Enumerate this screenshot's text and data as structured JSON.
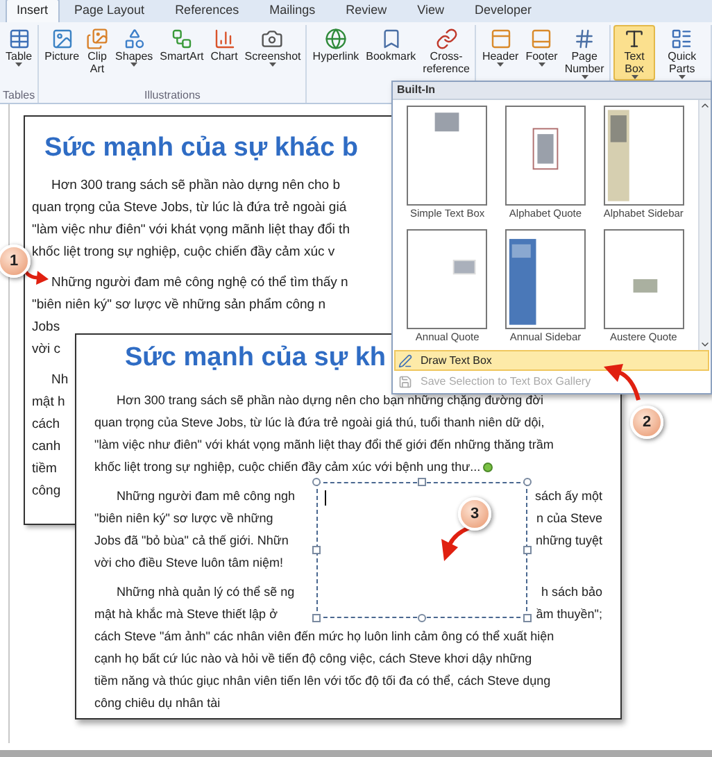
{
  "ribbon": {
    "tabs": [
      {
        "label": "Insert",
        "selected": true
      },
      {
        "label": "Page Layout",
        "selected": false
      },
      {
        "label": "References",
        "selected": false
      },
      {
        "label": "Mailings",
        "selected": false
      },
      {
        "label": "Review",
        "selected": false
      },
      {
        "label": "View",
        "selected": false
      },
      {
        "label": "Developer",
        "selected": false
      }
    ],
    "groups": [
      {
        "label": "Tables",
        "buttons": [
          {
            "label": "Table",
            "kind": "table",
            "dropdown": true,
            "selected": false
          }
        ]
      },
      {
        "label": "Illustrations",
        "buttons": [
          {
            "label": "Picture",
            "kind": "picture",
            "dropdown": false,
            "selected": false
          },
          {
            "label": "Clip Art",
            "kind": "clipart",
            "dropdown": false,
            "selected": false
          },
          {
            "label": "Shapes",
            "kind": "shapes",
            "dropdown": true,
            "selected": false
          },
          {
            "label": "SmartArt",
            "kind": "smartart",
            "dropdown": false,
            "selected": false
          },
          {
            "label": "Chart",
            "kind": "chart",
            "dropdown": false,
            "selected": false
          },
          {
            "label": "Screenshot",
            "kind": "screenshot",
            "dropdown": true,
            "selected": false
          }
        ]
      },
      {
        "buttons": [
          {
            "label": "Hyperlink",
            "kind": "hyperlink",
            "dropdown": false,
            "selected": false
          },
          {
            "label": "Bookmark",
            "kind": "bookmark",
            "dropdown": false,
            "selected": false
          },
          {
            "label": "Cross-reference",
            "kind": "crossref",
            "dropdown": false,
            "selected": false
          }
        ]
      },
      {
        "buttons": [
          {
            "label": "Header",
            "kind": "header",
            "dropdown": true,
            "selected": false
          },
          {
            "label": "Footer",
            "kind": "footer",
            "dropdown": true,
            "selected": false
          },
          {
            "label": "Page Number",
            "kind": "pagenumber",
            "dropdown": true,
            "selected": false
          }
        ]
      },
      {
        "buttons": [
          {
            "label": "Text Box",
            "kind": "textbox",
            "dropdown": true,
            "selected": true
          },
          {
            "label": "Quick Parts",
            "kind": "quickparts",
            "dropdown": true,
            "selected": false
          }
        ]
      }
    ]
  },
  "gallery": {
    "heading": "Built-In",
    "items": [
      {
        "caption": "Simple Text Box",
        "kind": "simple"
      },
      {
        "caption": "Alphabet Quote",
        "kind": "framed"
      },
      {
        "caption": "Alphabet Sidebar",
        "kind": "beige-sidebar"
      },
      {
        "caption": "Annual Quote",
        "kind": "right-quote"
      },
      {
        "caption": "Annual Sidebar",
        "kind": "blue-sidebar"
      },
      {
        "caption": "Austere Quote",
        "kind": "center-quote"
      }
    ],
    "commands": [
      {
        "label": "Draw Text Box",
        "selected": true,
        "disabled": false
      },
      {
        "label": "Save Selection to Text Box Gallery",
        "selected": false,
        "disabled": true
      }
    ]
  },
  "back_document": {
    "title": "Sức mạnh của sự khác b",
    "paragraphs": [
      [
        "Hơn 300 trang sách sẽ phần nào dựng nên cho b",
        "quan trọng của Steve Jobs, từ lúc là đứa trẻ ngoài giá",
        "\"làm việc như điên\" với khát vọng mãnh liệt thay đổi th",
        "khốc liệt trong sự nghiệp, cuộc chiến đầy cảm xúc v"
      ],
      [
        "Những người đam mê công nghệ có thể tìm thấy n",
        "\"biên niên ký\" sơ lược về những sản phẩm công n",
        "Jobs",
        "vời c"
      ],
      [
        "Nh",
        "mật h",
        "cách",
        "canh",
        "tiềm",
        "công"
      ]
    ]
  },
  "front_document": {
    "title": "Sức mạnh của sự kh",
    "paragraphs": [
      [
        {
          "text": "Hơn 300 trang sách sẽ phần nào dựng nên cho bạn những chặng đường đời"
        },
        {
          "text": "quan trọng của Steve Jobs, từ lúc là đứa trẻ ngoài giá thú, tuổi thanh niên dữ dội,"
        },
        {
          "text": "\"làm việc như điên\" với khát vọng mãnh liệt thay đổi thế giới đến những thăng trầm"
        },
        {
          "text": "khốc liệt trong sự nghiệp, cuộc chiến đầy cảm xúc với bệnh ung thư..."
        }
      ],
      [
        {
          "text": "Những người đam mê công ngh",
          "resumes": "sách ấy một"
        },
        {
          "text": "\"biên niên ký\" sơ lược về những",
          "resumes": "n của Steve"
        },
        {
          "text": "Jobs đã \"bỏ bùa\" cả thế giới. Nhữn",
          "resumes": "những tuyệt"
        },
        {
          "text": "vời cho điều Steve luôn tâm niệm!"
        }
      ],
      [
        {
          "text": "Những nhà quản lý có thể sẽ ng",
          "resumes": "h sách bảo"
        },
        {
          "text": "mật hà khắc mà Steve thiết lập ở",
          "resumes": "ầm thuyền\";"
        },
        {
          "text": "cách Steve \"ám ảnh\" các nhân viên đến mức họ luôn linh cảm ông có thể xuất hiện"
        },
        {
          "text": "cạnh họ bất cứ lúc nào và hỏi về tiến độ công việc, cách Steve khơi dậy những"
        },
        {
          "text": "tiềm năng và thúc giục nhân viên tiến lên với tốc độ tối đa có thể, cách Steve dụng"
        },
        {
          "text": "công chiêu dụ nhân tài"
        }
      ]
    ]
  },
  "callouts": [
    {
      "number": "1"
    },
    {
      "number": "2"
    },
    {
      "number": "3"
    }
  ]
}
